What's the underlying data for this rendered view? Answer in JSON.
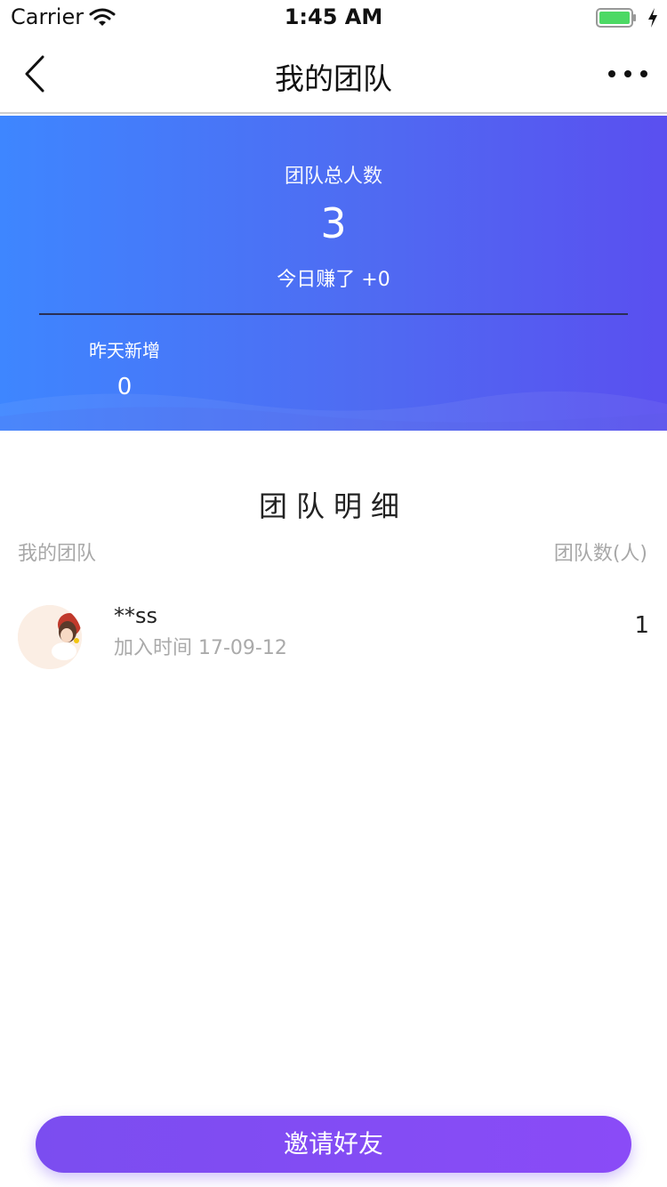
{
  "status_bar": {
    "carrier": "Carrier",
    "time": "1:45 AM",
    "battery_color": "#4cd964"
  },
  "nav": {
    "title": "我的团队"
  },
  "banner": {
    "total_label": "团队总人数",
    "total_value": "3",
    "today_text": "今日赚了 +0",
    "yesterday_label": "昨天新增",
    "yesterday_value": "0",
    "gradient_start": "#3e86ff",
    "gradient_end": "#5a4ff0"
  },
  "detail": {
    "title": "团队明细",
    "col_left": "我的团队",
    "col_right": "团队数(人)",
    "members": [
      {
        "name": "**ss",
        "joined": "加入时间 17-09-12",
        "count": "1"
      }
    ]
  },
  "invite": {
    "label": "邀请好友",
    "color": "#8a4bf7"
  }
}
